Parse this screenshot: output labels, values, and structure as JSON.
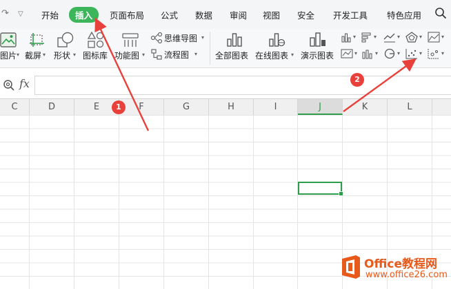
{
  "menubar": {
    "tabs": [
      {
        "label": "开始"
      },
      {
        "label": "插入"
      },
      {
        "label": "页面布局"
      },
      {
        "label": "公式"
      },
      {
        "label": "数据"
      },
      {
        "label": "审阅"
      },
      {
        "label": "视图"
      },
      {
        "label": "安全"
      },
      {
        "label": "开发工具"
      },
      {
        "label": "特色应用"
      }
    ],
    "active_tab": "插入"
  },
  "ribbon": {
    "buttons": [
      {
        "label": "图片"
      },
      {
        "label": "截屏"
      },
      {
        "label": "形状"
      },
      {
        "label": "图标库"
      },
      {
        "label": "功能图"
      },
      {
        "label": "思维导图"
      },
      {
        "label": "流程图"
      },
      {
        "label": "全部图表"
      },
      {
        "label": "在线图表"
      },
      {
        "label": "演示图表"
      }
    ]
  },
  "formula_bar": {
    "fx_label": "fx",
    "value": ""
  },
  "columns": [
    "C",
    "D",
    "E",
    "F",
    "G",
    "H",
    "I",
    "J",
    "K",
    "L"
  ],
  "selected_column": "J",
  "annotations": [
    {
      "label": "1"
    },
    {
      "label": "2"
    }
  ],
  "watermark": {
    "title": "Office教程网",
    "url": "www.office26.com"
  },
  "colors": {
    "accent": "#3db55a",
    "annotation": "#e8403a",
    "selection": "#2d9d4a",
    "watermark": "#e85a1b"
  }
}
